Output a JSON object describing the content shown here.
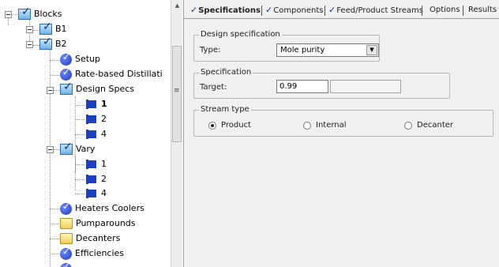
{
  "tree": {
    "blocks": "Blocks",
    "b1": "B1",
    "b2": "B2",
    "setup": "Setup",
    "rate_based": "Rate-based Distillati",
    "design_specs": "Design Specs",
    "spec_1": "1",
    "spec_2": "2",
    "spec_4": "4",
    "vary": "Vary",
    "vary_1": "1",
    "vary_2": "2",
    "vary_4": "4",
    "heaters_coolers": "Heaters Coolers",
    "pumparounds": "Pumparounds",
    "decanters": "Decanters",
    "efficiencies": "Efficiencies"
  },
  "tabs": [
    {
      "label": "Specifications",
      "checked": true,
      "active": true
    },
    {
      "label": "Components",
      "checked": true
    },
    {
      "label": "Feed/Product Streams",
      "checked": true
    },
    {
      "label": "Options",
      "checked": false
    },
    {
      "label": "Results",
      "checked": false
    }
  ],
  "design_spec": {
    "legend": "Design specification",
    "type_label": "Type:",
    "type_value": "Mole purity"
  },
  "specification": {
    "legend": "Specification",
    "target_label": "Target:",
    "target_value": "0.99"
  },
  "stream_type": {
    "legend": "Stream type",
    "options": [
      "Product",
      "Internal",
      "Decanter"
    ],
    "selected": "Product"
  },
  "colors": {
    "check_blue": "#1532c8",
    "panel_bg": "#f0f0f0",
    "folder_yellow": "#f0cf55"
  }
}
